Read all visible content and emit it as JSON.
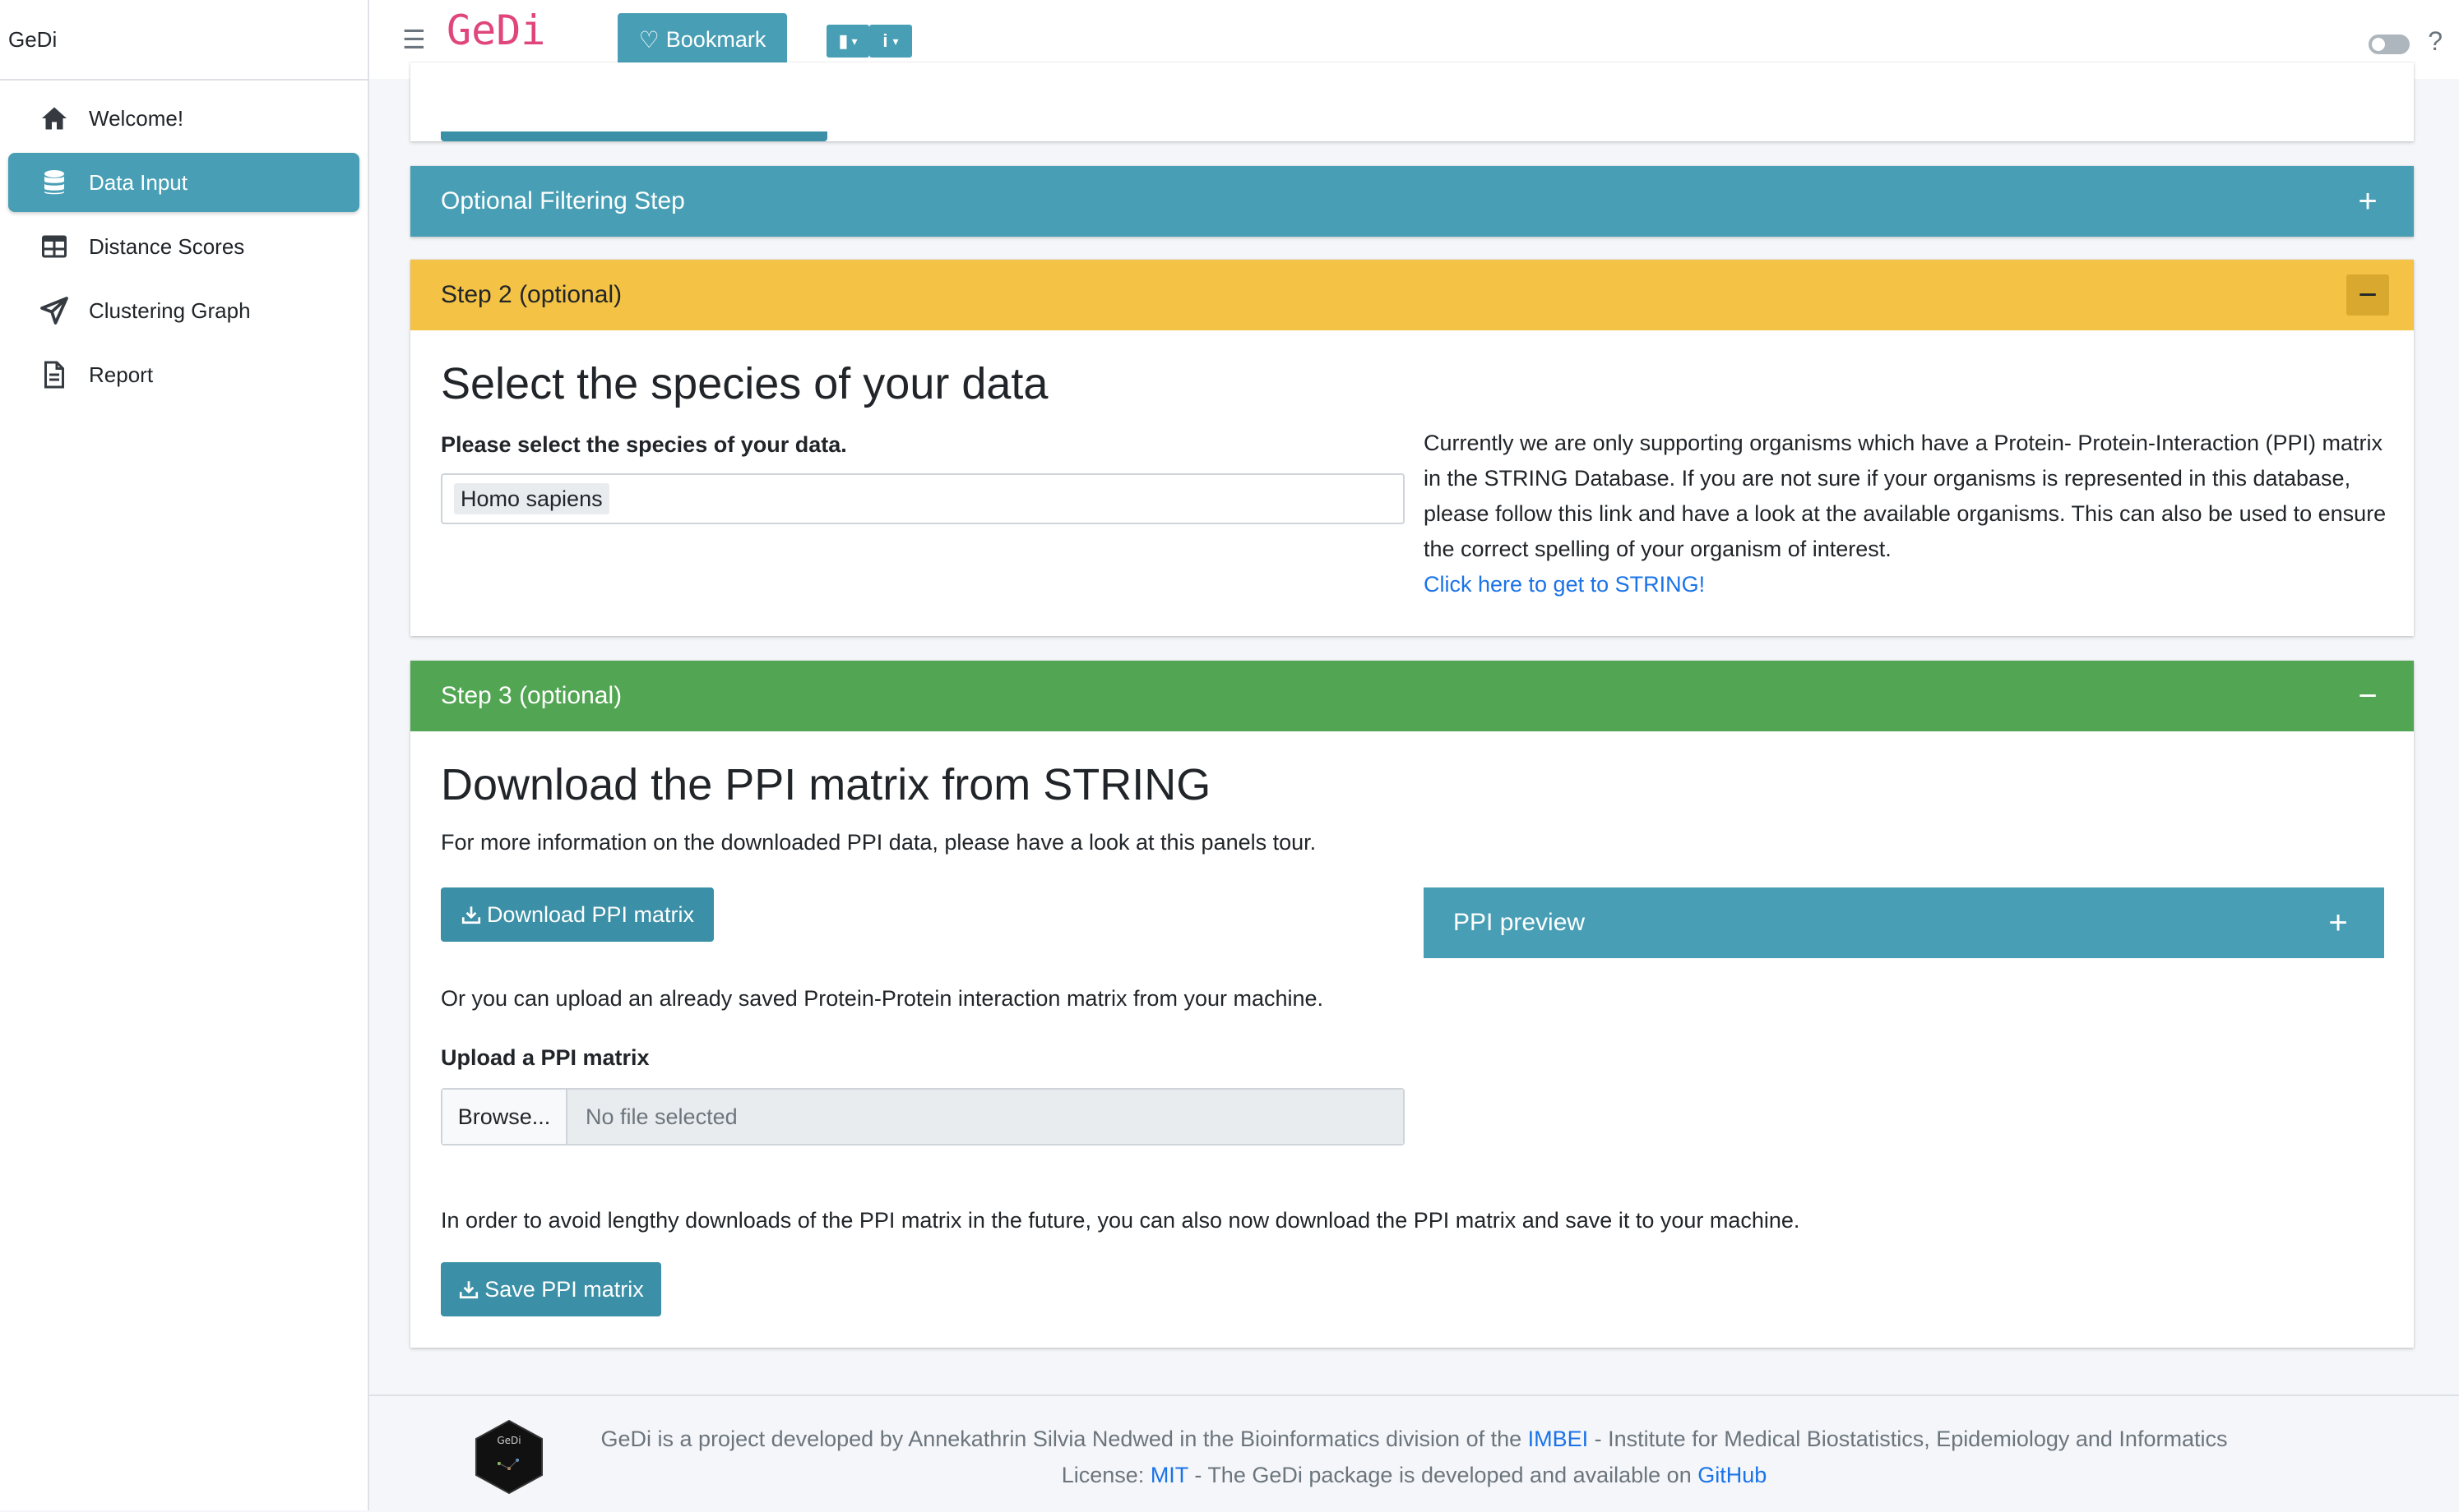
{
  "sidebar": {
    "brand": "GeDi",
    "items": [
      {
        "label": "Welcome!",
        "icon": "home-icon",
        "active": false
      },
      {
        "label": "Data Input",
        "icon": "database-icon",
        "active": true
      },
      {
        "label": "Distance Scores",
        "icon": "table-icon",
        "active": false
      },
      {
        "label": "Clustering Graph",
        "icon": "paper-plane-icon",
        "active": false
      },
      {
        "label": "Report",
        "icon": "file-icon",
        "active": false
      }
    ]
  },
  "header": {
    "logo": "GeDi",
    "bookmark_label": "Bookmark",
    "info_label": "i",
    "help": "?"
  },
  "filtering": {
    "title": "Optional Filtering Step",
    "tool": "+"
  },
  "step2": {
    "header": "Step 2 (optional)",
    "tool": "−",
    "heading": "Select the species of your data",
    "select_label": "Please select the species of your data.",
    "select_value": "Homo sapiens",
    "info_text": "Currently we are only supporting organisms which have a Protein- Protein-Interaction (PPI) matrix in the STRING Database. If you are not sure if your organisms is represented in this database, please follow this link and have a look at the available organisms. This can also be used to ensure the correct spelling of your organism of interest.",
    "link_text": "Click here to get to STRING!"
  },
  "step3": {
    "header": "Step 3 (optional)",
    "tool": "−",
    "heading": "Download the PPI matrix from STRING",
    "intro": "For more information on the downloaded PPI data, please have a look at this panels tour.",
    "download_label": "Download PPI matrix",
    "preview_title": "PPI preview",
    "preview_tool": "+",
    "upload_text": "Or you can upload an already saved Protein-Protein interaction matrix from your machine.",
    "upload_label": "Upload a PPI matrix",
    "browse_label": "Browse...",
    "file_placeholder": "No file selected",
    "save_text": "In order to avoid lengthy downloads of the PPI matrix in the future, you can also now download the PPI matrix and save it to your machine.",
    "save_label": "Save PPI matrix"
  },
  "footer": {
    "logo_text": "GeDi",
    "line1_pre": "GeDi is a project developed by Annekathrin Silvia Nedwed in the Bioinformatics division of the ",
    "line1_link": "IMBEI",
    "line1_post": " - Institute for Medical Biostatistics, Epidemiology and Informatics",
    "line2_pre": "License: ",
    "line2_link1": "MIT",
    "line2_mid": " - The GeDi package is developed and available on ",
    "line2_link2": "GitHub"
  },
  "colors": {
    "primary": "#489fb5",
    "warning": "#f4c244",
    "success": "#52a552",
    "logo": "#e0457b",
    "link": "#1a73e8"
  }
}
